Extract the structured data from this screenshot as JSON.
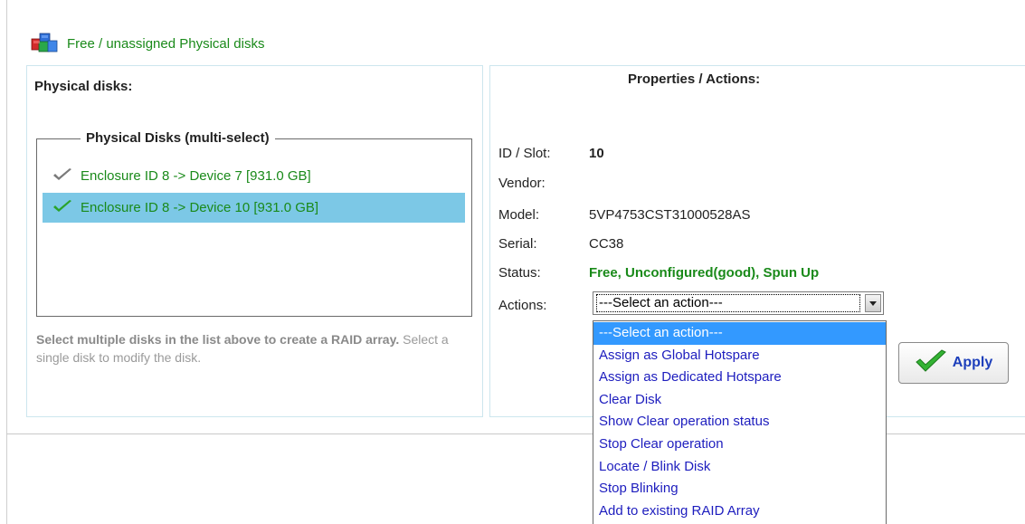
{
  "header": {
    "title": "Free / unassigned Physical disks",
    "icon": "disks-stack-icon"
  },
  "left_panel": {
    "heading": "Physical disks:",
    "fieldset_legend": "Physical Disks (multi-select)",
    "disks": [
      {
        "label": "Enclosure ID 8 -> Device 7 [931.0 GB]",
        "selected": false
      },
      {
        "label": "Enclosure ID 8 -> Device 10 [931.0 GB]",
        "selected": true
      }
    ],
    "hint_bold": "Select multiple disks in the list above to create a RAID array.",
    "hint_normal": " Select a single disk to modify the disk."
  },
  "right_panel": {
    "heading": "Properties / Actions:",
    "properties": {
      "id_slot_label": "ID / Slot:",
      "id_slot_value": "10",
      "vendor_label": "Vendor:",
      "vendor_value": "",
      "model_label": "Model:",
      "model_value": "5VP4753CST31000528AS",
      "serial_label": "Serial:",
      "serial_value": "CC38",
      "status_label": "Status:",
      "status_value": "Free, Unconfigured(good), Spun Up",
      "actions_label": "Actions:"
    },
    "actions_select": {
      "selected": "---Select an action---",
      "options": [
        "---Select an action---",
        "Assign as Global Hotspare",
        "Assign as Dedicated Hotspare",
        "Clear Disk",
        "Show Clear operation status",
        "Stop Clear operation",
        "Locate / Blink Disk",
        "Stop Blinking",
        "Add to existing RAID Array"
      ]
    },
    "apply_label": "Apply"
  },
  "colors": {
    "green_text": "#1a8a1a",
    "selected_row": "#7cc8e6",
    "dropdown_highlight": "#3399ff",
    "link_blue": "#1d1dbe"
  }
}
